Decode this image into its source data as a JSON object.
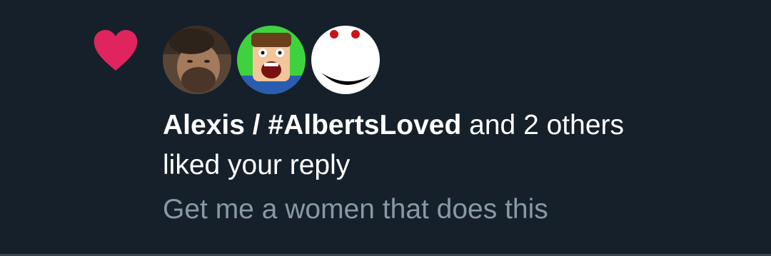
{
  "notification": {
    "type_icon": "heart-icon",
    "accent_color": "#e0245e",
    "actor_name": "Alexis / #AlbertsLoved",
    "others_text": "and 2 others",
    "action_text": "liked your reply",
    "tweet_preview": "Get me a women that does this",
    "avatars": [
      {
        "icon": "avatar-bearded-man"
      },
      {
        "icon": "avatar-roblox-screaming"
      },
      {
        "icon": "avatar-smiley-face"
      }
    ]
  },
  "colors": {
    "background": "#15202b",
    "primary_text": "#ffffff",
    "secondary_text": "#8899a6",
    "divider": "#38444d"
  }
}
